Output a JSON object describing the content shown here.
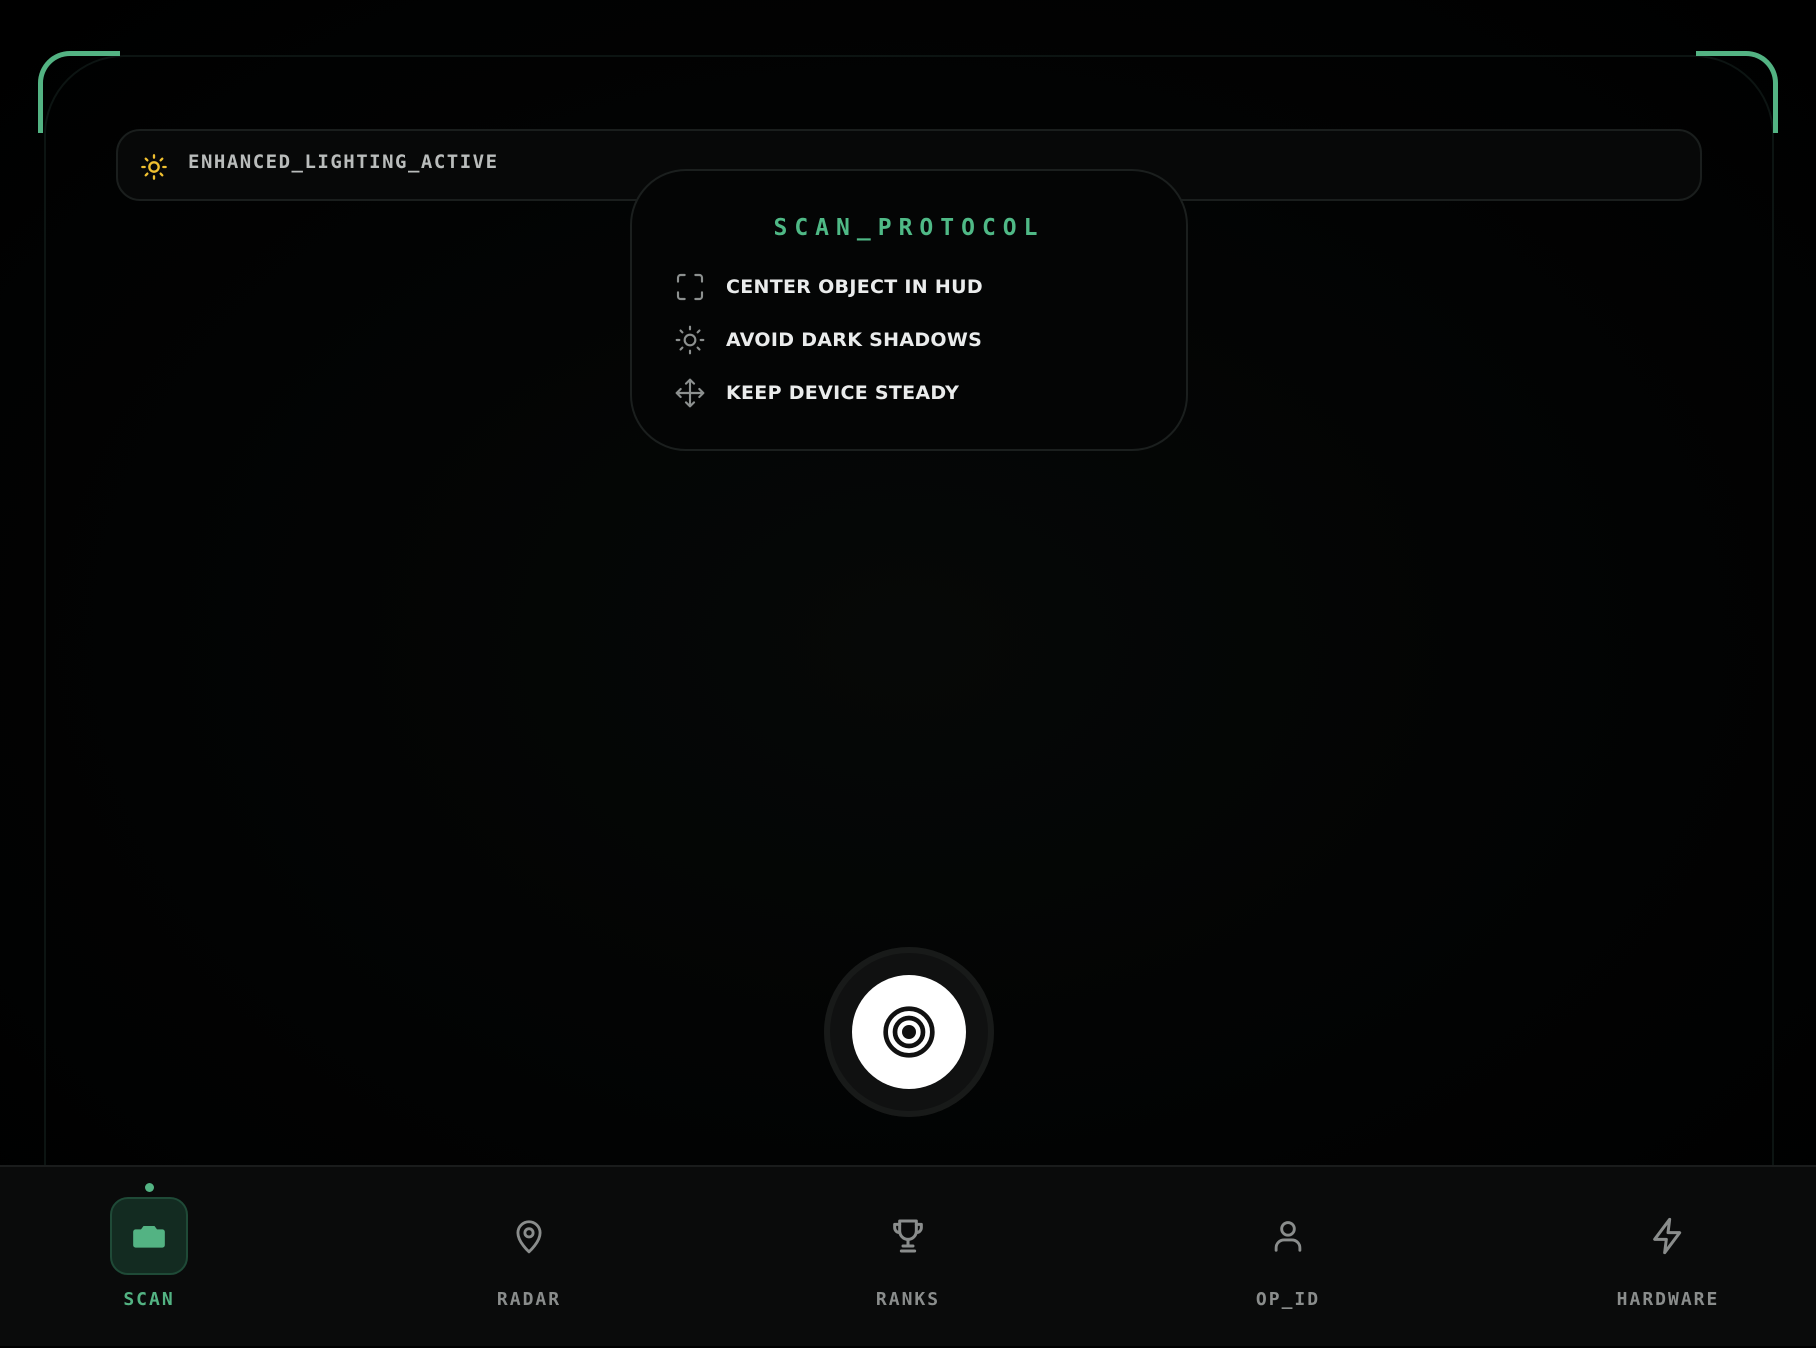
{
  "status": {
    "text": "ENHANCED_LIGHTING_ACTIVE",
    "icon": "sun-icon",
    "icon_color": "#f0c030"
  },
  "protocol": {
    "title": "SCAN_PROTOCOL",
    "steps": [
      {
        "icon": "focus-frame-icon",
        "text": "CENTER OBJECT IN HUD"
      },
      {
        "icon": "sun-icon",
        "text": "AVOID DARK SHADOWS"
      },
      {
        "icon": "move-icon",
        "text": "KEEP DEVICE STEADY"
      }
    ]
  },
  "shutter": {
    "icon": "target-icon"
  },
  "nav": {
    "items": [
      {
        "label": "SCAN",
        "icon": "camera-icon",
        "active": true
      },
      {
        "label": "RADAR",
        "icon": "map-pin-icon",
        "active": false
      },
      {
        "label": "RANKS",
        "icon": "trophy-icon",
        "active": false
      },
      {
        "label": "OP_ID",
        "icon": "user-icon",
        "active": false
      },
      {
        "label": "HARDWARE",
        "icon": "lightning-icon",
        "active": false
      }
    ]
  },
  "colors": {
    "accent": "#53b383",
    "background": "#000000",
    "nav_background": "#0a0b0b"
  }
}
